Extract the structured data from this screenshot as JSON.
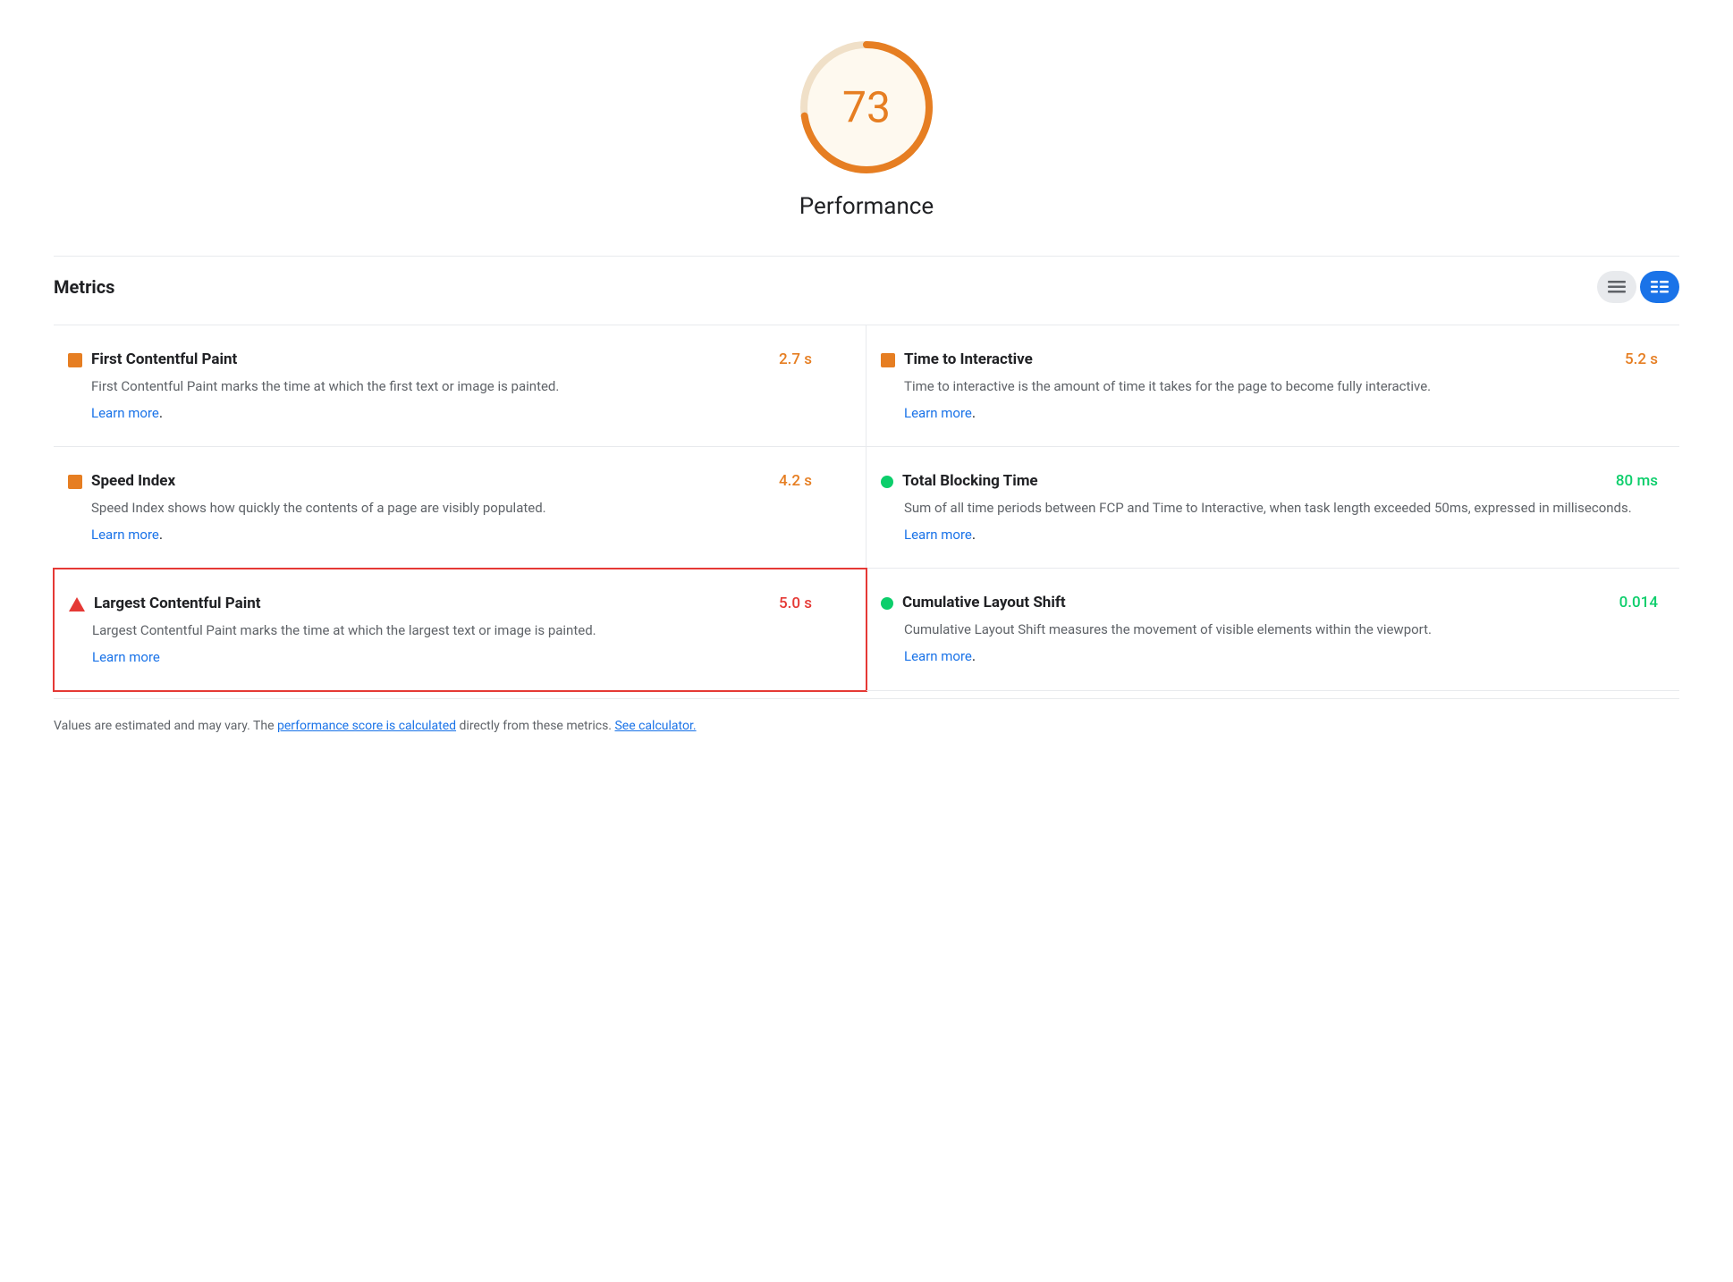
{
  "score": {
    "value": "73",
    "label": "Performance",
    "color": "#e67e22",
    "bg_color": "#fef9ef"
  },
  "metrics_section": {
    "title": "Metrics",
    "toggle": {
      "list_icon": "≡",
      "detail_icon": "≡"
    }
  },
  "metrics": [
    {
      "id": "fcp",
      "name": "First Contentful Paint",
      "value": "2.7 s",
      "value_color": "orange",
      "icon_type": "orange-square",
      "description": "First Contentful Paint marks the time at which the first text or image is painted.",
      "learn_more_text": "Learn more",
      "learn_more_href": "#",
      "highlighted": false,
      "column": "left"
    },
    {
      "id": "tti",
      "name": "Time to Interactive",
      "value": "5.2 s",
      "value_color": "orange",
      "icon_type": "orange-square",
      "description": "Time to interactive is the amount of time it takes for the page to become fully interactive.",
      "learn_more_text": "Learn more",
      "learn_more_href": "#",
      "highlighted": false,
      "column": "right"
    },
    {
      "id": "si",
      "name": "Speed Index",
      "value": "4.2 s",
      "value_color": "orange",
      "icon_type": "orange-square",
      "description": "Speed Index shows how quickly the contents of a page are visibly populated.",
      "learn_more_text": "Learn more",
      "learn_more_href": "#",
      "highlighted": false,
      "column": "left"
    },
    {
      "id": "tbt",
      "name": "Total Blocking Time",
      "value": "80 ms",
      "value_color": "green",
      "icon_type": "green-circle",
      "description": "Sum of all time periods between FCP and Time to Interactive, when task length exceeded 50ms, expressed in milliseconds.",
      "learn_more_text": "Learn more",
      "learn_more_href": "#",
      "highlighted": false,
      "column": "right"
    },
    {
      "id": "lcp",
      "name": "Largest Contentful Paint",
      "value": "5.0 s",
      "value_color": "red",
      "icon_type": "red-triangle",
      "description": "Largest Contentful Paint marks the time at which the largest text or image is painted.",
      "learn_more_text": "Learn more",
      "learn_more_href": "#",
      "highlighted": true,
      "column": "left"
    },
    {
      "id": "cls",
      "name": "Cumulative Layout Shift",
      "value": "0.014",
      "value_color": "green",
      "icon_type": "green-circle",
      "description": "Cumulative Layout Shift measures the movement of visible elements within the viewport.",
      "learn_more_text": "Learn more",
      "learn_more_href": "#",
      "highlighted": false,
      "column": "right"
    }
  ],
  "footer": {
    "text_before": "Values are estimated and may vary. The ",
    "link1_text": "performance score is calculated",
    "link1_href": "#",
    "text_middle": " directly from these metrics. ",
    "link2_text": "See calculator.",
    "link2_href": "#"
  }
}
